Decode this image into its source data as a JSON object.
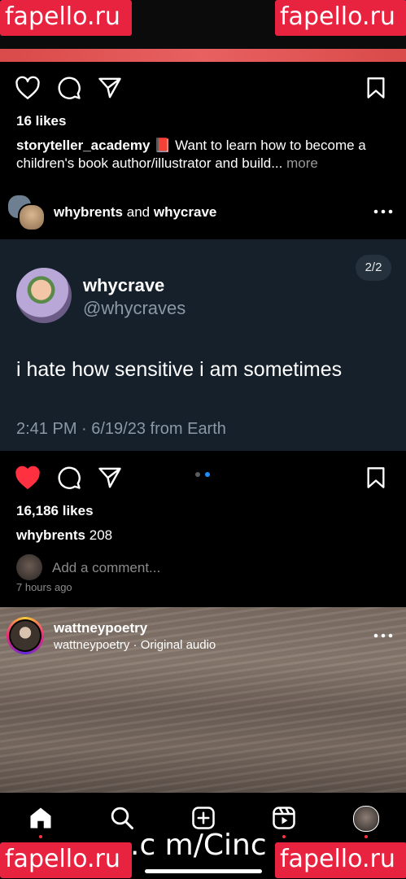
{
  "watermarks": [
    "fapello.ru",
    "fapello.ru",
    "fapello.ru",
    "fapello.ru"
  ],
  "bottom_watermark_text": ".c m/Cinc",
  "post1": {
    "likes": "16 likes",
    "caption_user": "storyteller_academy",
    "caption_emoji": "📕",
    "caption_text": "Want to learn how to become a children's book author/illustrator and build...",
    "more_label": "more"
  },
  "post2": {
    "header_user1": "whybrents",
    "header_and": "and",
    "header_user2": "whycrave",
    "tweet": {
      "name": "whycrave",
      "handle": "@whycraves",
      "text": "i hate how sensitive i am sometimes",
      "meta": "2:41 PM · 6/19/23 from Earth"
    },
    "counter": "2/2",
    "likes": "16,186 likes",
    "comment_user": "whybrents",
    "comment_count": "208",
    "add_comment_placeholder": "Add a comment...",
    "time_ago": "7 hours ago",
    "liked": true,
    "carousel_active_index": 1
  },
  "post3": {
    "user": "wattneypoetry",
    "subtitle": "wattneypoetry · Original audio"
  },
  "icons": {
    "like": "heart-icon",
    "comment": "comment-icon",
    "share": "share-icon",
    "save": "bookmark-icon",
    "more": "more-icon",
    "home": "home-icon",
    "search": "search-icon",
    "create": "create-icon",
    "reels": "reels-icon",
    "profile": "profile-avatar"
  },
  "colors": {
    "liked_heart": "#ff3040",
    "tweet_bg": "#15202b",
    "tweet_muted": "#8b98a5",
    "watermark": "#e8233f"
  }
}
